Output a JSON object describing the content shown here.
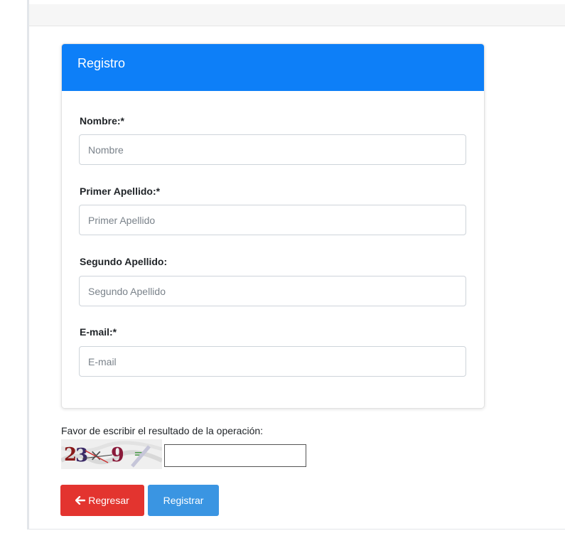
{
  "card": {
    "title": "Registro"
  },
  "fields": [
    {
      "label": "Nombre:*",
      "placeholder": "Nombre",
      "value": ""
    },
    {
      "label": "Primer Apellido:*",
      "placeholder": "Primer Apellido",
      "value": ""
    },
    {
      "label": "Segundo Apellido:",
      "placeholder": "Segundo Apellido",
      "value": ""
    },
    {
      "label": "E-mail:*",
      "placeholder": "E-mail",
      "value": ""
    }
  ],
  "captcha": {
    "prompt": "Favor de escribir el resultado de la operación:",
    "image_text": "23 × 9 =",
    "answer_value": ""
  },
  "buttons": {
    "back_label": "Regresar",
    "back_icon": "arrow-left-icon",
    "submit_label": "Registrar"
  },
  "colors": {
    "header_bg": "#0d7ff8",
    "back_button": "#e3342f",
    "submit_button": "#3a95e2"
  }
}
